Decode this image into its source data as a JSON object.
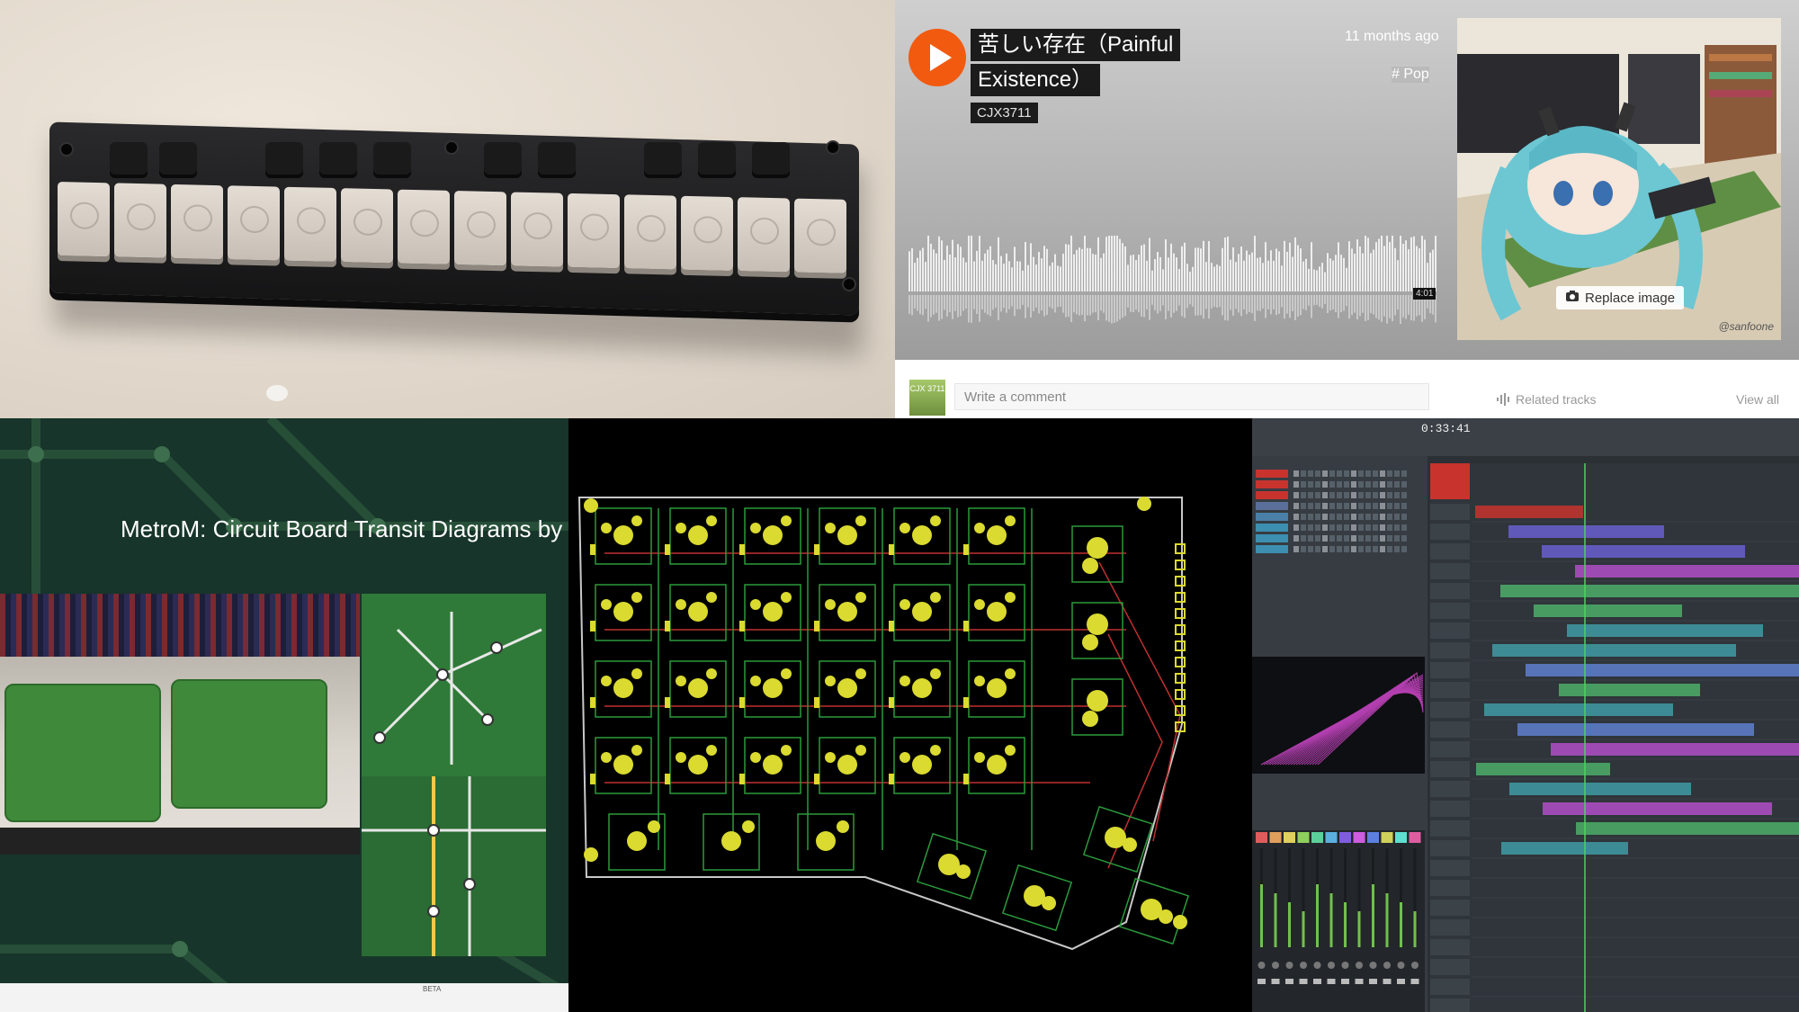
{
  "track": {
    "title_line1": "苦しい存在（Painful",
    "title_line2": "Existence）",
    "artist": "CJX3711",
    "posted": "11 months ago",
    "genre": "# Pop",
    "duration": "4:01",
    "replace_image_label": "Replace image",
    "artwork_credit": "@sanfoone",
    "comment_placeholder": "Write a comment",
    "related_label": "Related tracks",
    "view_all_label": "View all",
    "avatar_text": "CJX 3711",
    "accent": "#f25a0f"
  },
  "metro": {
    "title": "MetroM: Circuit Board Transit Diagrams by",
    "bottom_text": "BETA"
  },
  "daw": {
    "clock": "0:33:41"
  }
}
